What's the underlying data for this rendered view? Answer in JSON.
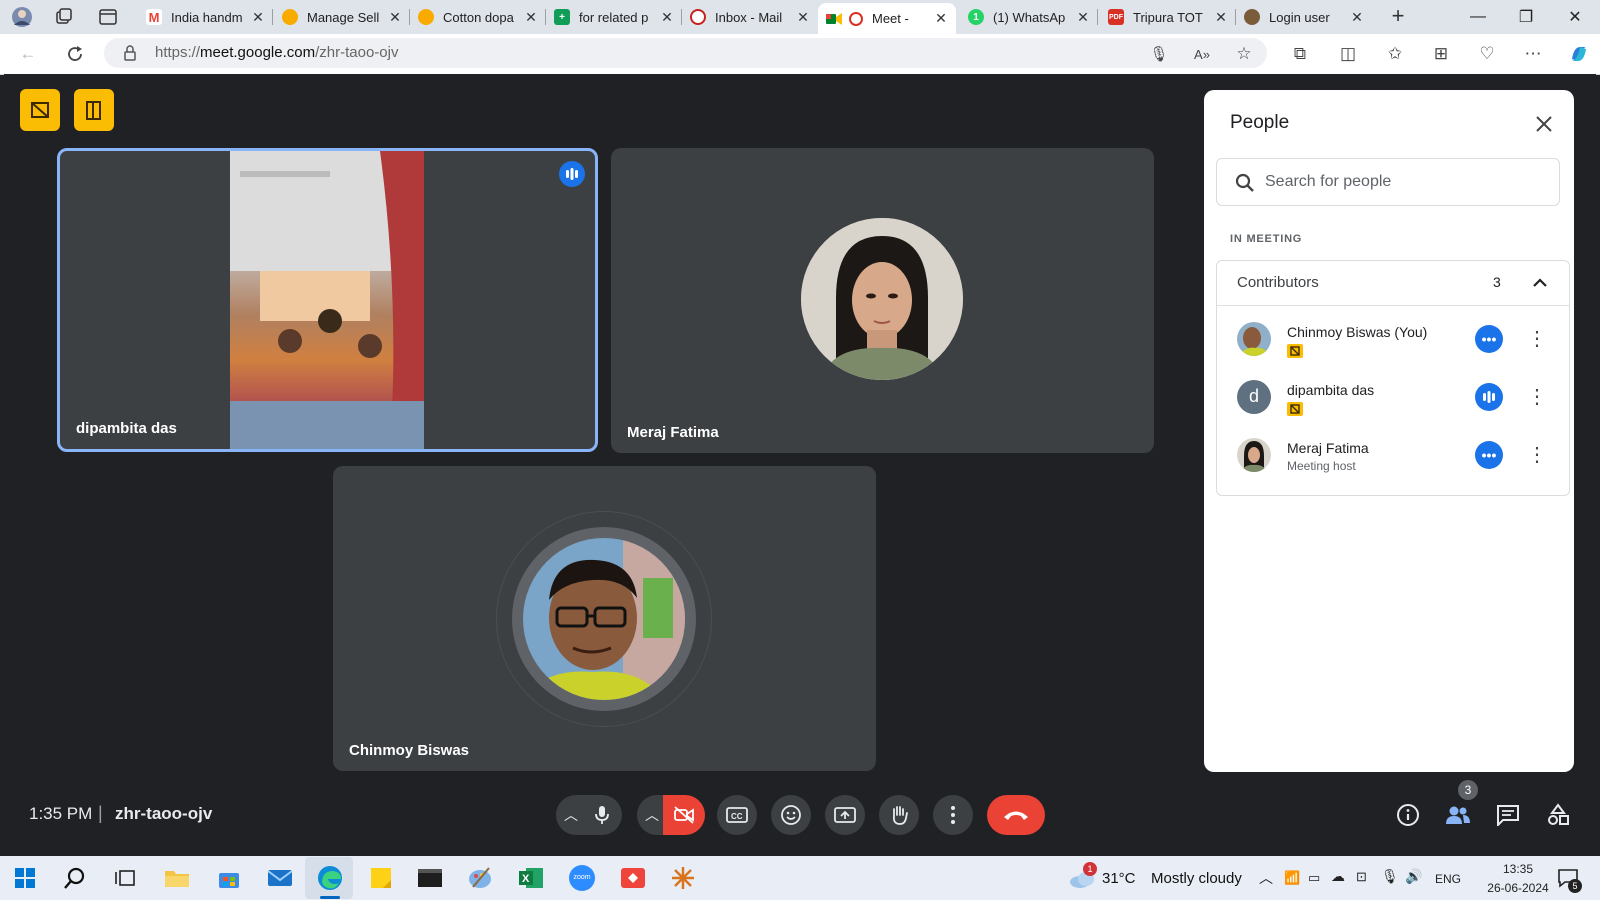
{
  "browser": {
    "tabs": [
      {
        "label": "India handm",
        "color": "#ea4335"
      },
      {
        "label": "Manage Sell",
        "color": "#f9ab00"
      },
      {
        "label": "Cotton dopa",
        "color": "#f9ab00"
      },
      {
        "label": "for related p",
        "color": "#0f9d58"
      },
      {
        "label": "Inbox - Mail",
        "color": "#c5221f"
      },
      {
        "label": "Meet - ",
        "color": "#1a73e8"
      },
      {
        "label": "(1) WhatsAp",
        "color": "#25d366"
      },
      {
        "label": "Tripura TOT",
        "color": "#d93025"
      },
      {
        "label": "Login user",
        "color": "#7a5c3a"
      }
    ],
    "url_prefix": "https://",
    "url_domain": "meet.google.com",
    "url_path": "/zhr-taoo-ojv"
  },
  "meet": {
    "tiles": [
      {
        "name": "dipambita das"
      },
      {
        "name": "Meraj Fatima"
      },
      {
        "name": "Chinmoy Biswas"
      }
    ],
    "time": "1:35 PM",
    "separator": "|",
    "meeting_code": "zhr-taoo-ojv",
    "people_badge": "3"
  },
  "people_panel": {
    "title": "People",
    "search_placeholder": "Search for people",
    "section_label": "IN MEETING",
    "group_label": "Contributors",
    "group_count": "3",
    "participants": [
      {
        "name": "Chinmoy Biswas (You)",
        "sub": "",
        "initial": ""
      },
      {
        "name": "dipambita das",
        "sub": "",
        "initial": "d"
      },
      {
        "name": "Meraj Fatima",
        "sub": "Meeting host",
        "initial": ""
      }
    ]
  },
  "taskbar": {
    "weather_temp": "31°C",
    "weather_desc": "Mostly cloudy",
    "weather_badge": "1",
    "language": "ENG",
    "clock_time": "13:35",
    "clock_date": "26-06-2024",
    "notification_count": "5",
    "zoom_label": "zoom"
  },
  "colors": {
    "meet_bg": "#202124",
    "tile_bg": "#3c4043",
    "accent_blue": "#1a73e8",
    "end_call_red": "#ea4335",
    "host_button_yellow": "#fbbc04"
  }
}
